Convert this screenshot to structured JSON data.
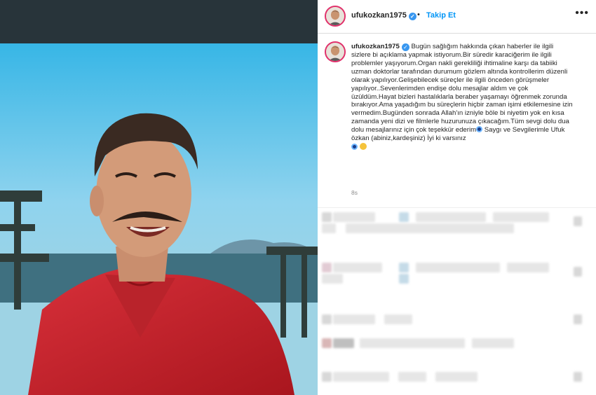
{
  "post": {
    "username": "ufukozkan1975",
    "verified": true,
    "follow_label": "Takip Et",
    "more_icon": "more-horizontal-icon",
    "caption_user": "ufukozkan1975",
    "caption_text": "Bugün sağlığım hakkında çıkan haberler ile ilgili sizlere bi açıklama yapmak istiyorum.Bir süredir karaciğerim ile ilgili problemler yaşıyorum.Organ nakli gerekliliği ihtimaline karşı da tabiiki uzman doktorlar tarafından durumum gözlem altında kontrollerim düzenli olarak yapılıyor.Gelişebilecek süreçler ile ilgili önceden görüşmeler yapılıyor..Sevenlerimden endişe dolu mesajlar aldım ve çok üzüldüm.Hayat bizleri hastalıklarla beraber yaşamayı öğrenmek zorunda bırakıyor.Ama yaşadığım bu süreçlerin hiçbir zaman işimi etkilemesine izin vermedim.Bugünden sonrada Allah'ın izniyle böle bi niyetim yok en kısa zamanda yeni dizi ve filmlerle huzurunuza çıkacağım.Tüm sevgi dolu dua dolu mesajlarınız için çok teşekkür ederim",
    "caption_text_2": "Saygı ve Sevgilerimle Ufuk özkan (abiniz,kardeşiniz) İyi ki varsınız",
    "emojis": [
      "nazar-eye-emoji",
      "nazar-eye-emoji",
      "smiling-face-emoji"
    ],
    "time_ago": "8s"
  },
  "colors": {
    "accent": "#0095f6",
    "verified": "#3897f0",
    "media_bg": "#28343a",
    "shirt_red": "#c8232b"
  }
}
